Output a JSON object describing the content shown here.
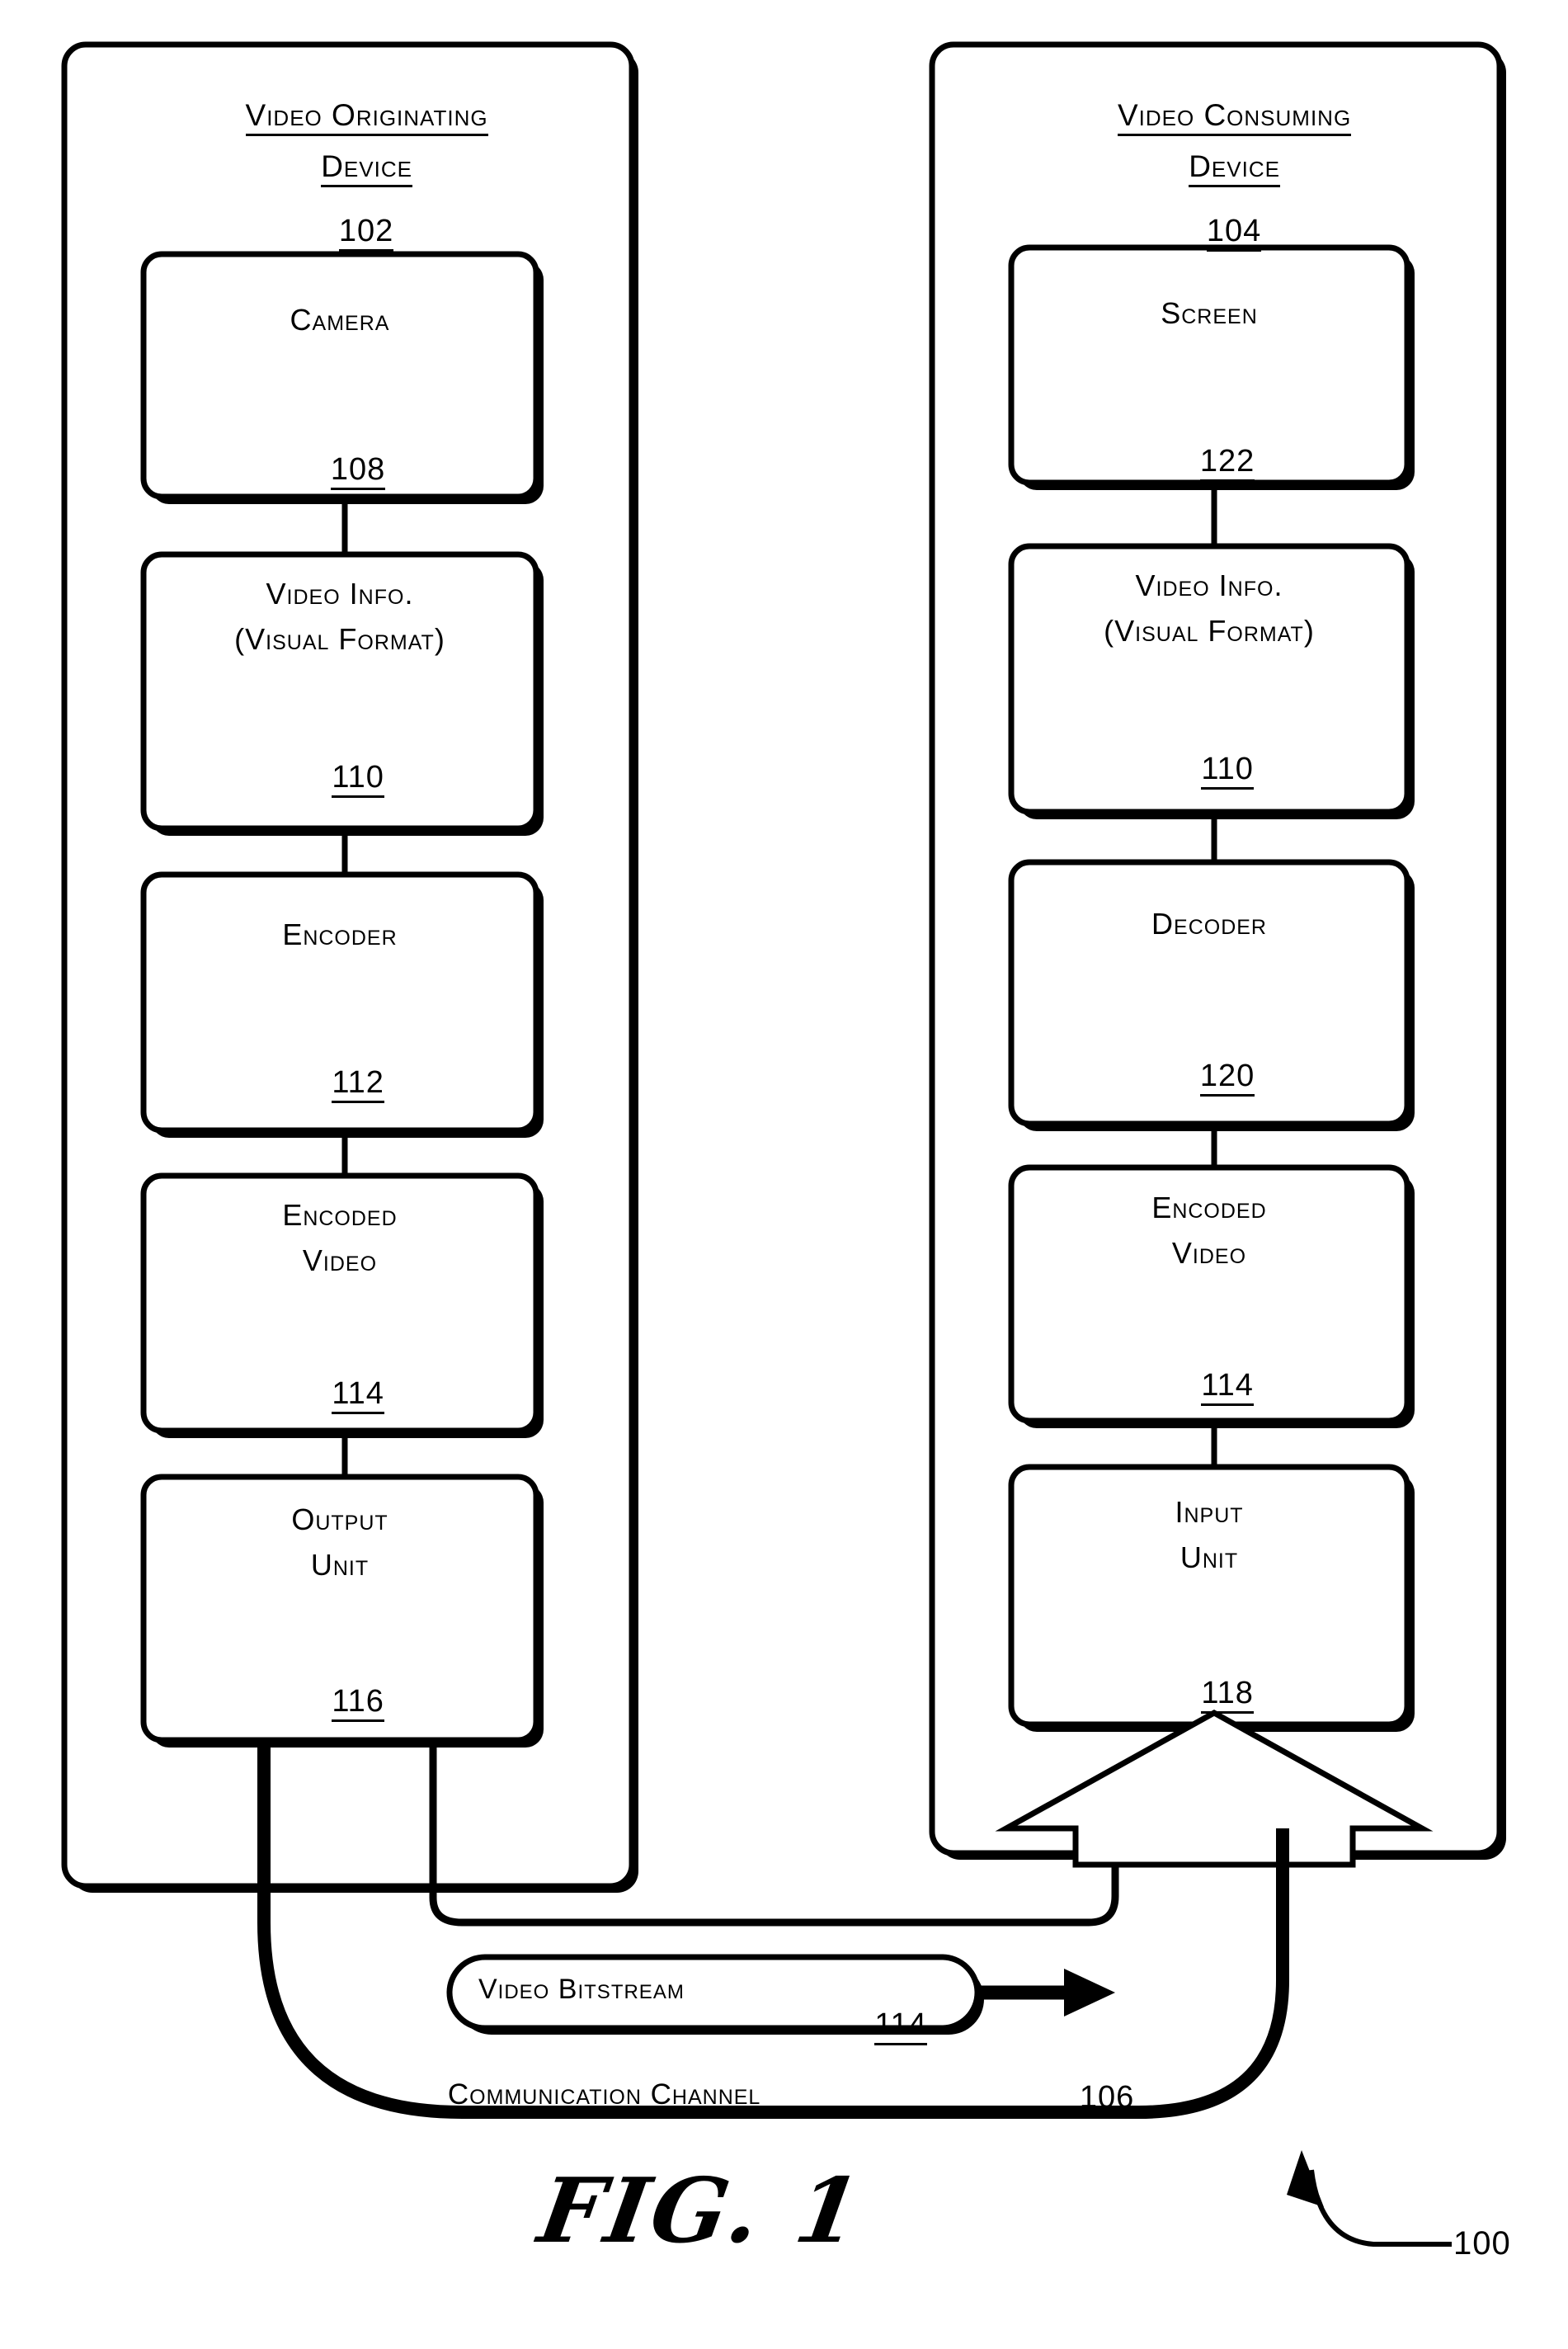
{
  "figure": {
    "caption": "FIG. 1",
    "system_ref": "100"
  },
  "panels": [
    {
      "id": "video-originating-device",
      "title_line1": "Video Originating",
      "title_line2": "Device",
      "ref": "102",
      "boxes": [
        {
          "id": "camera",
          "line1": "Camera",
          "line2": "",
          "ref": "108"
        },
        {
          "id": "video-info-src",
          "line1": "Video Info.",
          "line2": "(Visual Format)",
          "ref": "110"
        },
        {
          "id": "encoder",
          "line1": "Encoder",
          "line2": "",
          "ref": "112"
        },
        {
          "id": "encoded-video-src",
          "line1": "Encoded",
          "line2": "Video",
          "ref": "114"
        },
        {
          "id": "output-unit",
          "line1": "Output",
          "line2": "Unit",
          "ref": "116"
        }
      ]
    },
    {
      "id": "video-consuming-device",
      "title_line1": "Video Consuming",
      "title_line2": "Device",
      "ref": "104",
      "boxes": [
        {
          "id": "screen",
          "line1": "Screen",
          "line2": "",
          "ref": "122"
        },
        {
          "id": "video-info-dst",
          "line1": "Video Info.",
          "line2": "(Visual Format)",
          "ref": "110"
        },
        {
          "id": "decoder",
          "line1": "Decoder",
          "line2": "",
          "ref": "120"
        },
        {
          "id": "encoded-video-dst",
          "line1": "Encoded",
          "line2": "Video",
          "ref": "114"
        },
        {
          "id": "input-unit",
          "line1": "Input",
          "line2": "Unit",
          "ref": "118"
        }
      ]
    }
  ],
  "channel": {
    "bitstream_label": "Video Bitstream",
    "bitstream_ref": "114",
    "channel_label": "Communication Channel",
    "channel_ref": "106"
  },
  "colors": {
    "stroke": "#000000",
    "background": "#ffffff"
  }
}
